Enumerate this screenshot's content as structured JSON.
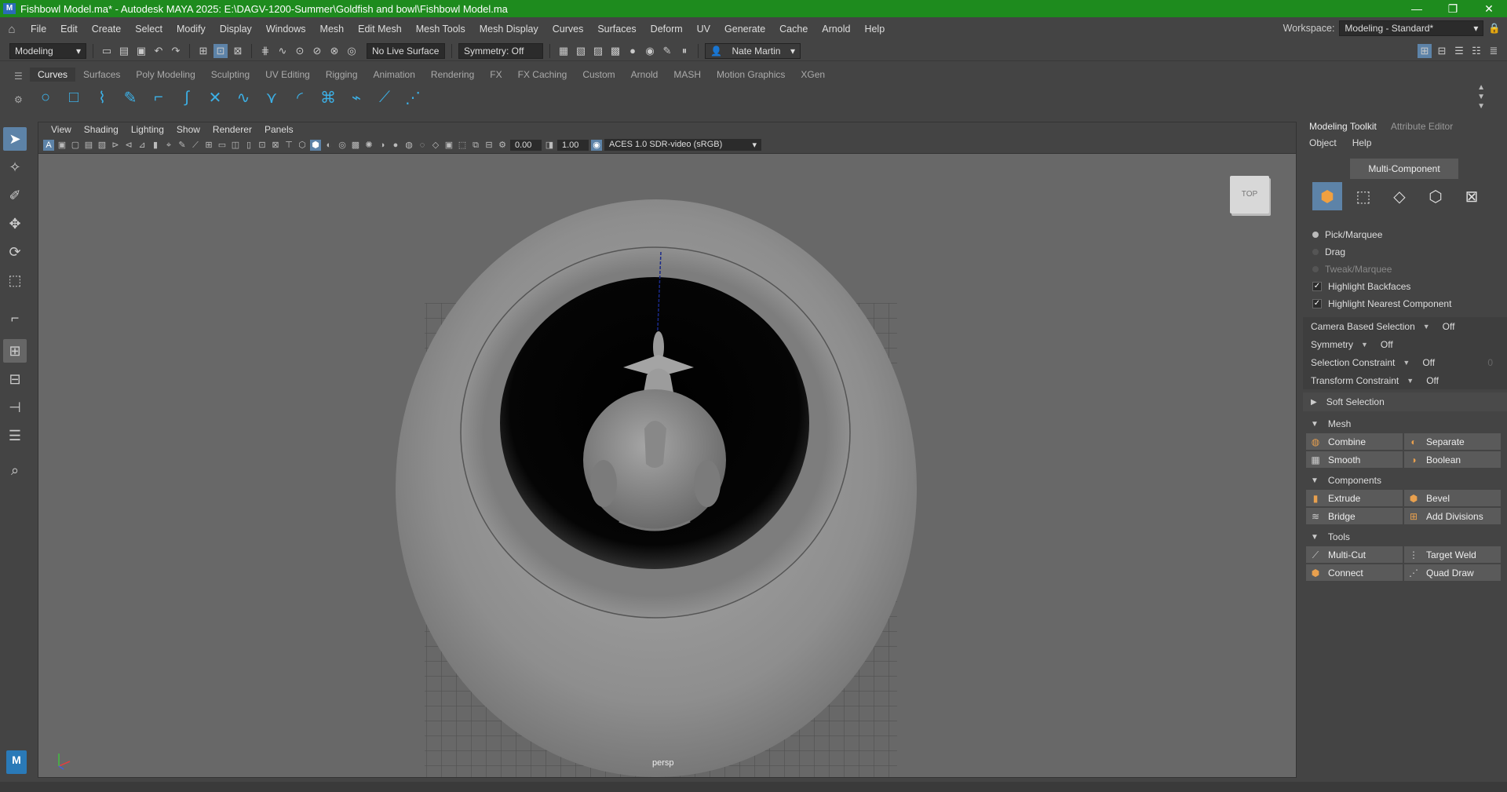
{
  "window": {
    "title": "Fishbowl Model.ma* - Autodesk MAYA 2025: E:\\DAGV-1200-Summer\\Goldfish and bowl\\Fishbowl Model.ma",
    "logo_letter": "M",
    "controls": [
      "—",
      "❐",
      "✕"
    ]
  },
  "menubar": {
    "items": [
      "File",
      "Edit",
      "Create",
      "Select",
      "Modify",
      "Display",
      "Windows",
      "Mesh",
      "Edit Mesh",
      "Mesh Tools",
      "Mesh Display",
      "Curves",
      "Surfaces",
      "Deform",
      "UV",
      "Generate",
      "Cache",
      "Arnold",
      "Help"
    ],
    "workspace_label": "Workspace:",
    "workspace_value": "Modeling - Standard*"
  },
  "statusline": {
    "mode": "Modeling",
    "live_surface": "No Live Surface",
    "symmetry": "Symmetry: Off",
    "user": "Nate Martin"
  },
  "shelf": {
    "tabs": [
      "Curves",
      "Surfaces",
      "Poly Modeling",
      "Sculpting",
      "UV Editing",
      "Rigging",
      "Animation",
      "Rendering",
      "FX",
      "FX Caching",
      "Custom",
      "Arnold",
      "MASH",
      "Motion Graphics",
      "XGen"
    ],
    "active_tab": "Curves"
  },
  "viewport": {
    "menu": [
      "View",
      "Shading",
      "Lighting",
      "Show",
      "Renderer",
      "Panels"
    ],
    "exposure": "0.00",
    "gamma": "1.00",
    "colorspace": "ACES 1.0 SDR-video (sRGB)",
    "viewcube_label": "TOP",
    "camera_label": "persp"
  },
  "panel": {
    "tabs": [
      "Modeling Toolkit",
      "Attribute Editor"
    ],
    "menu": [
      "Object",
      "Help"
    ],
    "multi_component": "Multi-Component",
    "pick_options": [
      {
        "label": "Pick/Marquee",
        "state": "on"
      },
      {
        "label": "Drag",
        "state": "off"
      },
      {
        "label": "Tweak/Marquee",
        "state": "disabled"
      }
    ],
    "checks": [
      {
        "label": "Highlight Backfaces",
        "checked": true
      },
      {
        "label": "Highlight Nearest Component",
        "checked": true
      }
    ],
    "settings": [
      {
        "label": "Camera Based Selection",
        "value": "Off",
        "extra": ""
      },
      {
        "label": "Symmetry",
        "value": "Off",
        "extra": ""
      },
      {
        "label": "Selection Constraint",
        "value": "Off",
        "extra": "0"
      },
      {
        "label": "Transform Constraint",
        "value": "Off",
        "extra": ""
      }
    ],
    "soft_selection": "Soft Selection",
    "mesh_title": "Mesh",
    "mesh_buttons": [
      "Combine",
      "Separate",
      "Smooth",
      "Boolean"
    ],
    "components_title": "Components",
    "components_buttons": [
      "Extrude",
      "Bevel",
      "Bridge",
      "Add Divisions"
    ],
    "tools_title": "Tools",
    "tools_buttons": [
      "Multi-Cut",
      "Target Weld",
      "Connect",
      "Quad Draw"
    ]
  }
}
